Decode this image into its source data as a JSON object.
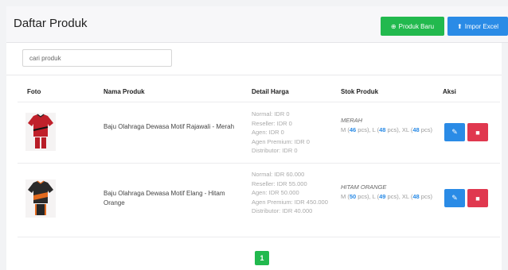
{
  "header": {
    "title": "Daftar Produk",
    "new_product_label": "Produk Baru",
    "import_label": "Impor Excel"
  },
  "search": {
    "placeholder": "cari produk"
  },
  "table": {
    "columns": [
      "Foto",
      "Nama Produk",
      "Detail Harga",
      "Stok Produk",
      "Aksi"
    ],
    "rows": [
      {
        "name": "Baju Olahraga Dewasa Motif Rajawali - Merah",
        "prices": [
          "Normal: IDR 0",
          "Reseller: IDR 0",
          "Agen: IDR 0",
          "Agen Premium: IDR 0",
          "Distributor: IDR 0"
        ],
        "stock_color": "MERAH",
        "stock": {
          "m": "46",
          "l": "48",
          "xl": "48"
        },
        "shirt_color": "#c0202a"
      },
      {
        "name": "Baju Olahraga Dewasa Motif Elang - Hitam Orange",
        "prices": [
          "Normal: IDR 60.000",
          "Reseller: IDR 55.000",
          "Agen: IDR 50.000",
          "Agen Premium: IDR 450.000",
          "Distributor: IDR 40.000"
        ],
        "stock_color": "HITAM ORANGE",
        "stock": {
          "m": "50",
          "l": "49",
          "xl": "48"
        },
        "shirt_color": "#2a2a2a"
      }
    ]
  },
  "pagination": {
    "current": "1"
  },
  "colors": {
    "green": "#22b94e",
    "blue": "#2a8be6",
    "red": "#e0384f"
  }
}
